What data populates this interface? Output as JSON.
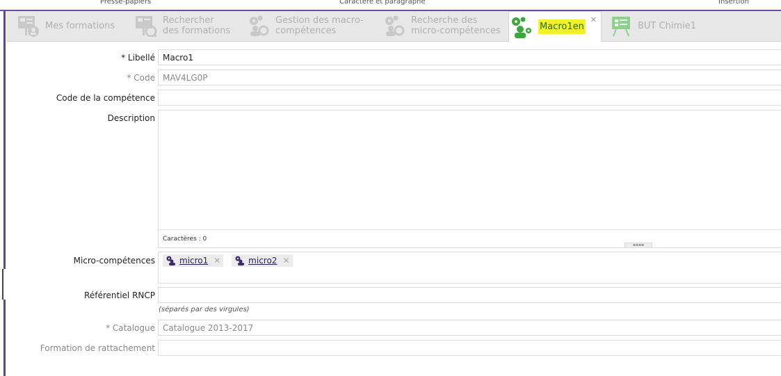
{
  "ribbon": {
    "group1": "Presse-papiers",
    "group2": "Caractère et paragraphe",
    "group3": "Insertion"
  },
  "tabs": [
    {
      "label": "Mes formations",
      "icon": "formation-user-icon",
      "active": false
    },
    {
      "label": "Rechercher des formations",
      "icon": "search-formation-icon",
      "active": false
    },
    {
      "label": "Gestion des macro-compétences",
      "icon": "gears-people-icon",
      "active": false
    },
    {
      "label": "Recherche des micro-compétences",
      "icon": "gears-search-icon",
      "active": false
    },
    {
      "label": "Macro1en",
      "icon": "gear-person-icon",
      "active": true
    },
    {
      "label": "BUT Chimie1",
      "icon": "easel-icon",
      "active": false
    }
  ],
  "form": {
    "libelle_label": "* Libellé",
    "libelle_value": "Macro1",
    "code_label": "* Code",
    "code_value": "MAV4LG0P",
    "code_competence_label": "Code de la compétence",
    "code_competence_value": "",
    "description_label": "Description",
    "description_chars": "Caractères : 0",
    "micro_label": "Micro-compétences",
    "micro_items": [
      "micro1",
      "micro2"
    ],
    "rncp_label": "Référentiel RNCP",
    "rncp_value": "",
    "rncp_hint": "(séparés par des virgules)",
    "catalogue_label": "* Catalogue",
    "catalogue_value": "Catalogue 2013-2017",
    "rattachement_label": "Formation de rattachement",
    "rattachement_value": ""
  },
  "colors": {
    "accent_purple": "#6a3e9b",
    "active_green": "#3aa83a",
    "highlight_yellow": "#f3f12a"
  }
}
